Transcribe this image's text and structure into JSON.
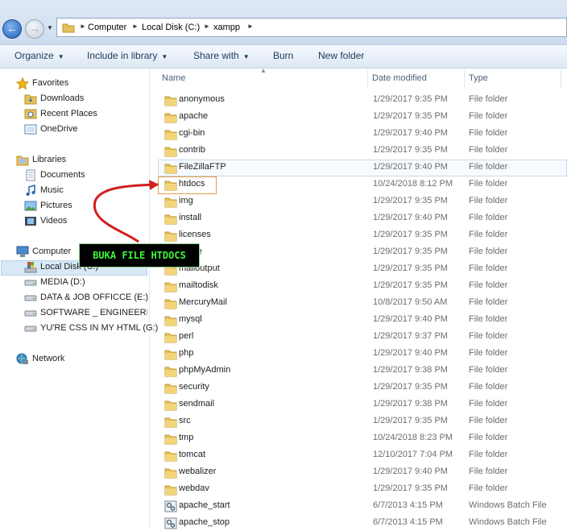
{
  "address": {
    "crumbs": [
      "Computer",
      "Local Disk (C:)",
      "xampp"
    ]
  },
  "toolbar": {
    "organize": "Organize",
    "include": "Include in library",
    "share": "Share with",
    "burn": "Burn",
    "new_folder": "New folder"
  },
  "nav": {
    "favorites": "Favorites",
    "downloads": "Downloads",
    "recent": "Recent Places",
    "onedrive": "OneDrive",
    "libraries": "Libraries",
    "documents": "Documents",
    "music": "Music",
    "pictures": "Pictures",
    "videos": "Videos",
    "computer": "Computer",
    "local_disk": "Local Disk (C:)",
    "media": "MEDIA  (D:)",
    "data": "DATA & JOB OFFICCE (E:)",
    "software": "SOFTWARE _ ENGINEERING",
    "css": "YU'RE CSS IN MY HTML (G:)",
    "network": "Network"
  },
  "columns": {
    "name": "Name",
    "date": "Date modified",
    "type": "Type"
  },
  "files": [
    {
      "name": "anonymous",
      "date": "1/29/2017 9:35 PM",
      "type": "File folder"
    },
    {
      "name": "apache",
      "date": "1/29/2017 9:35 PM",
      "type": "File folder"
    },
    {
      "name": "cgi-bin",
      "date": "1/29/2017 9:40 PM",
      "type": "File folder"
    },
    {
      "name": "contrib",
      "date": "1/29/2017 9:35 PM",
      "type": "File folder"
    },
    {
      "name": "FileZillaFTP",
      "date": "1/29/2017 9:40 PM",
      "type": "File folder"
    },
    {
      "name": "htdocs",
      "date": "10/24/2018 8:12 PM",
      "type": "File folder"
    },
    {
      "name": "img",
      "date": "1/29/2017 9:35 PM",
      "type": "File folder"
    },
    {
      "name": "install",
      "date": "1/29/2017 9:40 PM",
      "type": "File folder"
    },
    {
      "name": "licenses",
      "date": "1/29/2017 9:35 PM",
      "type": "File folder"
    },
    {
      "name": "locale",
      "date": "1/29/2017 9:35 PM",
      "type": "File folder"
    },
    {
      "name": "mailoutput",
      "date": "1/29/2017 9:35 PM",
      "type": "File folder"
    },
    {
      "name": "mailtodisk",
      "date": "1/29/2017 9:35 PM",
      "type": "File folder"
    },
    {
      "name": "MercuryMail",
      "date": "10/8/2017 9:50 AM",
      "type": "File folder"
    },
    {
      "name": "mysql",
      "date": "1/29/2017 9:40 PM",
      "type": "File folder"
    },
    {
      "name": "perl",
      "date": "1/29/2017 9:37 PM",
      "type": "File folder"
    },
    {
      "name": "php",
      "date": "1/29/2017 9:40 PM",
      "type": "File folder"
    },
    {
      "name": "phpMyAdmin",
      "date": "1/29/2017 9:38 PM",
      "type": "File folder"
    },
    {
      "name": "security",
      "date": "1/29/2017 9:35 PM",
      "type": "File folder"
    },
    {
      "name": "sendmail",
      "date": "1/29/2017 9:38 PM",
      "type": "File folder"
    },
    {
      "name": "src",
      "date": "1/29/2017 9:35 PM",
      "type": "File folder"
    },
    {
      "name": "tmp",
      "date": "10/24/2018 8:23 PM",
      "type": "File folder"
    },
    {
      "name": "tomcat",
      "date": "12/10/2017 7:04 PM",
      "type": "File folder"
    },
    {
      "name": "webalizer",
      "date": "1/29/2017 9:40 PM",
      "type": "File folder"
    },
    {
      "name": "webdav",
      "date": "1/29/2017 9:35 PM",
      "type": "File folder"
    },
    {
      "name": "apache_start",
      "date": "6/7/2013 4:15 PM",
      "type": "Windows Batch File"
    },
    {
      "name": "apache_stop",
      "date": "6/7/2013 4:15 PM",
      "type": "Windows Batch File"
    }
  ],
  "callout": "BUKA FILE HTDOCS",
  "colors": {
    "folder": "#e8c15a",
    "callout_text": "#3cf53c",
    "arrow": "#d21f1f",
    "highlight_border": "#e8994e"
  }
}
